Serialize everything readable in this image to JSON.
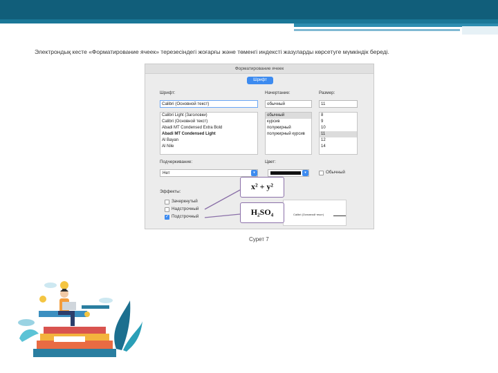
{
  "intro_text": "Электрондық кесте «Форматирование ячеек» терезесіндегі жоғарғы және төменгі индексті жазуларды көрсетуге мүмкіндік береді.",
  "caption": "Сурет 7",
  "dialog": {
    "title": "Форматирование ячеек",
    "tab": "Шрифт",
    "font_label": "Шрифт:",
    "font_value": "Calibri (Основной текст)",
    "font_list": [
      "Calibri Light (Заголовки)",
      "Calibri (Основной текст)",
      "Abadi MT Condensed Extra Bold",
      "Abadi MT Condensed Light",
      "Al Bayan",
      "Al Nile"
    ],
    "style_label": "Начертание:",
    "style_value": "обычный",
    "style_list": [
      "обычный",
      "курсив",
      "полужирный",
      "полужирный курсив"
    ],
    "size_label": "Размер:",
    "size_value": "11",
    "size_list": [
      "8",
      "9",
      "10",
      "11",
      "12",
      "14"
    ],
    "underline_label": "Подчеркивание:",
    "underline_value": "Нет",
    "color_label": "Цвет:",
    "normal_label": "Обычный",
    "effects_label": "Эффекты:",
    "effects": [
      {
        "label": "Зачеркнутый",
        "checked": false
      },
      {
        "label": "Надстрочный",
        "checked": false
      },
      {
        "label": "Подстрочный",
        "checked": true
      }
    ],
    "preview_text": "Calibri (Основной текст)"
  },
  "callouts": {
    "superscript_example": "x² + y²",
    "subscript_example": "H₂SO₄"
  },
  "colors": {
    "header": "#115e7a",
    "accent": "#3d8bf0",
    "callout_border": "#8a6fa8"
  }
}
